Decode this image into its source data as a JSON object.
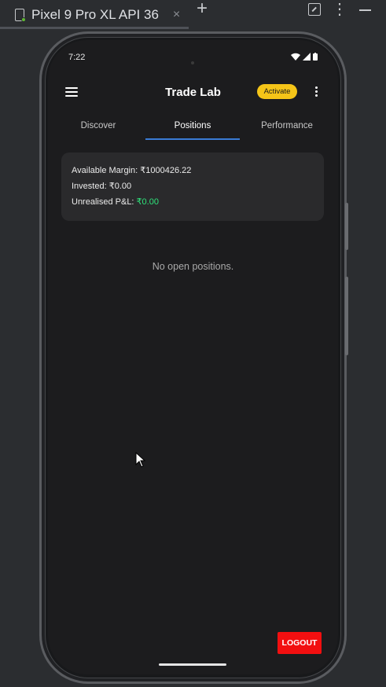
{
  "window": {
    "tab_title": "Pixel 9 Pro XL API 36",
    "tab_close": "×",
    "add_tab": "+"
  },
  "status_bar": {
    "time": "7:22"
  },
  "app_bar": {
    "title": "Trade Lab",
    "activate_label": "Activate",
    "accent_color": "#f5c518"
  },
  "tabs": [
    {
      "label": "Discover",
      "active": false
    },
    {
      "label": "Positions",
      "active": true
    },
    {
      "label": "Performance",
      "active": false
    }
  ],
  "summary": {
    "available_margin_label": "Available Margin: ",
    "available_margin_value": "₹1000426.22",
    "invested_label": "Invested: ",
    "invested_value": "₹0.00",
    "unrealised_pnl_label": "Unrealised P&L: ",
    "unrealised_pnl_value": "₹0.00",
    "pnl_color": "#2ee37a"
  },
  "empty_state": "No open positions.",
  "logout_label": "LOGOUT",
  "logout_color": "#f20f10",
  "icons": [
    "device-icon",
    "close-icon",
    "add-icon",
    "collapse-icon",
    "more-vert-icon",
    "minimize-icon",
    "wifi-icon",
    "signal-icon",
    "battery-icon",
    "menu-icon"
  ]
}
